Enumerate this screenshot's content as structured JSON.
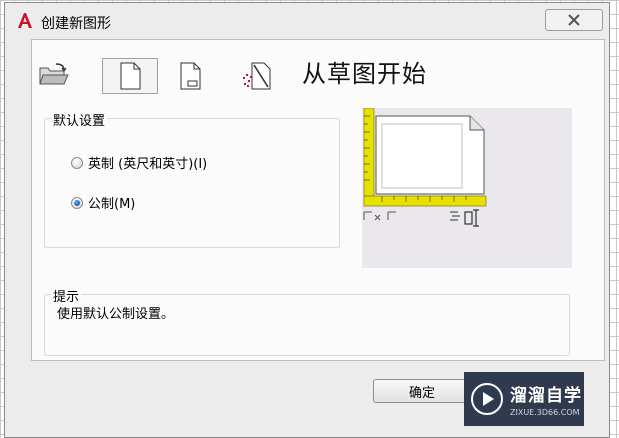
{
  "window": {
    "title": "创建新图形",
    "close_label": "X"
  },
  "toolbar": {
    "items": [
      {
        "name": "open-drawing",
        "selected": false
      },
      {
        "name": "start-from-scratch",
        "selected": true
      },
      {
        "name": "use-template",
        "selected": false
      },
      {
        "name": "use-wizard",
        "selected": false
      }
    ]
  },
  "main": {
    "heading": "从草图开始",
    "default_settings": {
      "label": "默认设置",
      "options": [
        {
          "label": "英制 (英尺和英寸)(I)",
          "checked": false
        },
        {
          "label": "公制(M)",
          "checked": true
        }
      ]
    },
    "hint": {
      "label": "提示",
      "text": "使用默认公制设置。"
    }
  },
  "footer": {
    "ok_label": "确定"
  },
  "watermark": {
    "title": "溜溜自学",
    "subtitle": "ZIXUE.3D66.COM"
  },
  "colors": {
    "ruler": "#e8e000",
    "accent_red": "#c8102e",
    "watermark_bg": "#2f3a4f"
  }
}
